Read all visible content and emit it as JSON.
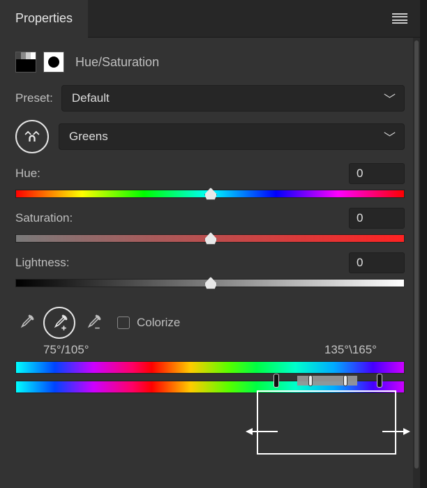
{
  "panel": {
    "tab_label": "Properties",
    "adjustment_name": "Hue/Saturation"
  },
  "preset": {
    "label": "Preset:",
    "value": "Default"
  },
  "channel": {
    "value": "Greens"
  },
  "sliders": {
    "hue": {
      "label": "Hue:",
      "value": "0"
    },
    "saturation": {
      "label": "Saturation:",
      "value": "0"
    },
    "lightness": {
      "label": "Lightness:",
      "value": "0"
    }
  },
  "colorize": {
    "label": "Colorize",
    "checked": false
  },
  "range": {
    "left_label": "75°/105°",
    "right_label": "135°\\165°"
  }
}
